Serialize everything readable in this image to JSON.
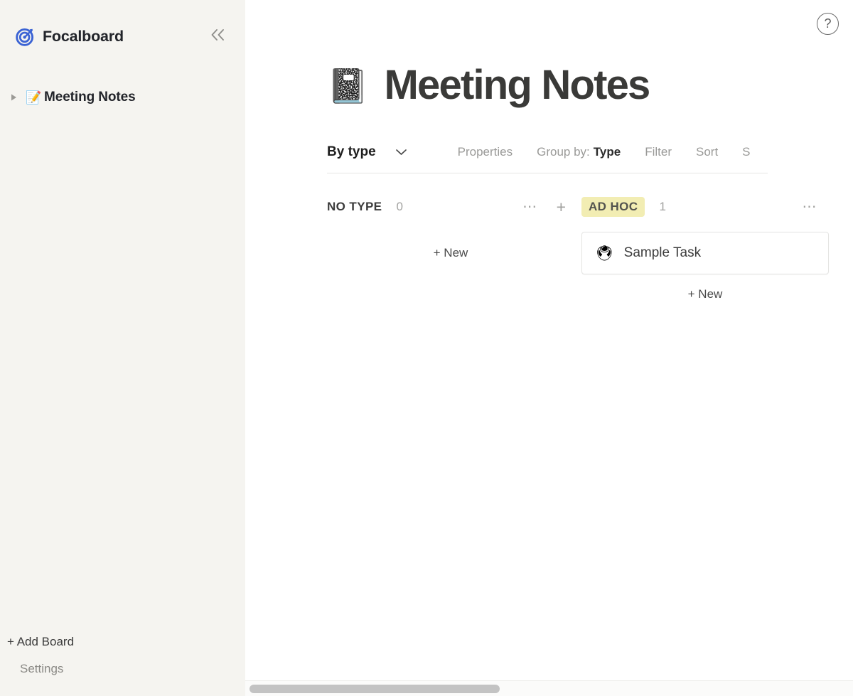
{
  "app": {
    "brand_name": "Focalboard",
    "brand_logo_icon": "target-dart-logo",
    "collapse_icon": "double-chevron-left-icon"
  },
  "sidebar": {
    "boards": [
      {
        "caret_icon": "caret-right-icon",
        "emoji": "📝",
        "emoji_icon": "memo-emoji",
        "label": "Meeting Notes"
      }
    ],
    "add_board_label": "+ Add Board",
    "settings_label": "Settings"
  },
  "topbar": {
    "help_label": "?",
    "help_icon": "question-mark-circle-icon"
  },
  "board": {
    "emoji": "📓",
    "emoji_icon": "notebook-emoji",
    "title": "Meeting Notes"
  },
  "toolbar": {
    "view_name": "By type",
    "chevron_icon": "chevron-down-icon",
    "properties_label": "Properties",
    "group_by_prefix": "Group by:",
    "group_by_value": "Type",
    "filter_label": "Filter",
    "sort_label": "Sort",
    "search_label": "S"
  },
  "kanban": {
    "new_label": "+ New",
    "menu_icon": "ellipsis-horizontal-icon",
    "add_icon": "plus-icon",
    "columns": [
      {
        "title": "NO TYPE",
        "count": "0",
        "is_badge": false,
        "badge_color": "",
        "has_add": true,
        "cards": []
      },
      {
        "title": "AD HOC",
        "count": "1",
        "is_badge": true,
        "badge_color": "#f2edb3",
        "has_add": false,
        "cards": [
          {
            "emoji": "🖲",
            "emoji_icon": "trackball-emoji",
            "title": "Sample Task"
          }
        ]
      }
    ]
  },
  "scrollbar": {
    "orientation": "horizontal",
    "thumb_label": ""
  },
  "colors": {
    "sidebar_bg": "#f5f4f0",
    "main_bg": "#ffffff",
    "brand_blue": "#3b63d4",
    "text_dark": "#22242a",
    "text_muted": "#9a9a98",
    "badge_yellow": "#f2edb3"
  }
}
